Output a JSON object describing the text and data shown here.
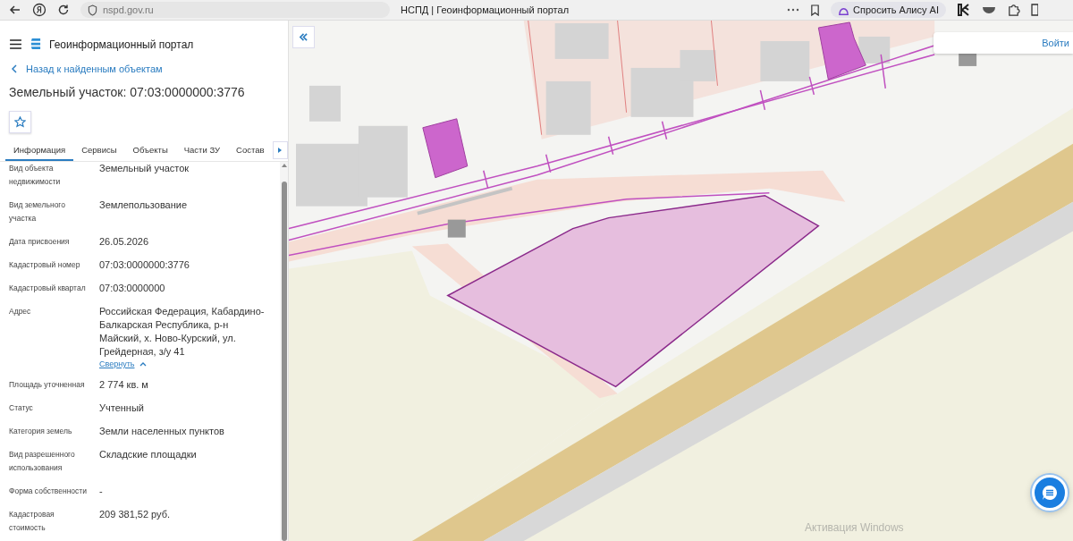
{
  "browser": {
    "url": "nspd.gov.ru",
    "tab_title": "НСПД | Геоинформационный портал",
    "assistant_button": "Спросить Алису AI"
  },
  "app": {
    "title": "Геоинформационный портал"
  },
  "sidebar": {
    "back_link": "Назад к найденным объектам",
    "object_title": "Земельный участок: 07:03:0000000:3776",
    "tabs": [
      {
        "label": "Информация",
        "selected": true
      },
      {
        "label": "Сервисы",
        "selected": false
      },
      {
        "label": "Объекты",
        "selected": false
      },
      {
        "label": "Части ЗУ",
        "selected": false
      },
      {
        "label": "Состав",
        "selected": false
      }
    ],
    "fields": [
      {
        "label": "Вид объекта недвижимости",
        "value": "Земельный участок"
      },
      {
        "label": "Вид земельного участка",
        "value": "Землепользование"
      },
      {
        "label": "Дата присвоения",
        "value": "26.05.2026"
      },
      {
        "label": "Кадастровый номер",
        "value": "07:03:0000000:3776"
      },
      {
        "label": "Кадастровый квартал",
        "value": "07:03:0000000"
      },
      {
        "label": "Адрес",
        "value": "Российская Федерация, Кабардино-Балкарская Республика, р-н Майский, х. Ново-Курский, ул. Грейдерная, з/у 41",
        "link": "Свернуть"
      },
      {
        "label": "Площадь уточненная",
        "value": "2 774 кв. м"
      },
      {
        "label": "Статус",
        "value": "Учтенный"
      },
      {
        "label": "Категория земель",
        "value": "Земли населенных пунктов"
      },
      {
        "label": "Вид разрешенного использования",
        "value": "Складские площадки"
      },
      {
        "label": "Форма собственности",
        "value": "-"
      },
      {
        "label": "Кадастровая стоимость",
        "value": "209 381,52 руб."
      }
    ]
  },
  "map": {
    "login_button": "Войти"
  },
  "system_overlay": {
    "activation_title": "Активация Windows"
  }
}
